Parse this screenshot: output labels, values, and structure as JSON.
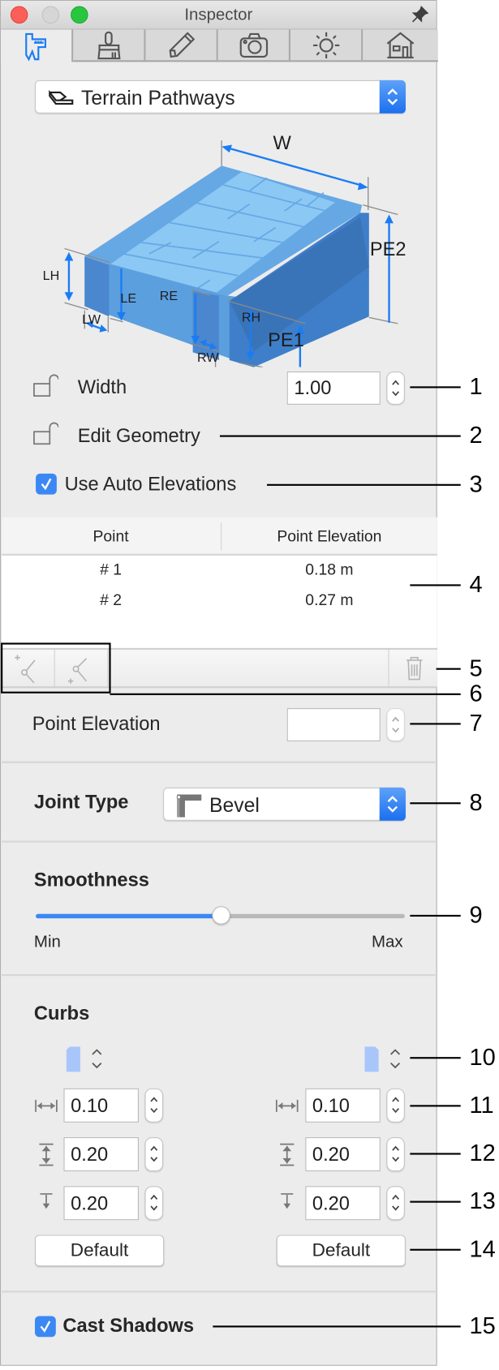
{
  "window": {
    "title": "Inspector",
    "tabs": [
      {
        "name": "measure-tab",
        "icon": "caliper-icon",
        "active": true
      },
      {
        "name": "material-tab",
        "icon": "brush-icon",
        "active": false
      },
      {
        "name": "edit-tab",
        "icon": "pencil-icon",
        "active": false
      },
      {
        "name": "camera-tab",
        "icon": "camera-icon",
        "active": false
      },
      {
        "name": "light-tab",
        "icon": "sun-icon",
        "active": false
      },
      {
        "name": "building-tab",
        "icon": "house-icon",
        "active": false
      }
    ]
  },
  "type_selector": {
    "value": "Terrain Pathways",
    "icon": "terrain-pathway-icon"
  },
  "diagram": {
    "labels": {
      "w": "W",
      "pe2": "PE2",
      "pe1": "PE1",
      "lh": "LH",
      "le": "LE",
      "re": "RE",
      "rh": "RH",
      "lw": "LW",
      "rw": "RW"
    }
  },
  "width": {
    "label": "Width",
    "value": "1.00"
  },
  "edit_geometry": {
    "label": "Edit Geometry"
  },
  "auto_elevations": {
    "label": "Use Auto Elevations",
    "checked": true
  },
  "points_table": {
    "columns": [
      "Point",
      "Point Elevation"
    ],
    "rows": [
      {
        "point": "# 1",
        "elevation": "0.18 m"
      },
      {
        "point": "# 2",
        "elevation": "0.27 m"
      }
    ]
  },
  "point_elevation": {
    "label": "Point Elevation",
    "value": ""
  },
  "joint_type": {
    "label": "Joint Type",
    "value": "Bevel"
  },
  "smoothness": {
    "label": "Smoothness",
    "min_label": "Min",
    "max_label": "Max",
    "value_fraction": 0.5
  },
  "curbs": {
    "label": "Curbs",
    "left": {
      "width": "0.10",
      "height": "0.20",
      "elevation": "0.20",
      "default_label": "Default"
    },
    "right": {
      "width": "0.10",
      "height": "0.20",
      "elevation": "0.20",
      "default_label": "Default"
    }
  },
  "cast_shadows": {
    "label": "Cast Shadows",
    "checked": true
  },
  "callouts": [
    "1",
    "2",
    "3",
    "4",
    "5",
    "6",
    "7",
    "8",
    "9",
    "10",
    "11",
    "12",
    "13",
    "14",
    "15"
  ],
  "colors": {
    "accent": "#3b88f5",
    "close": "#fc5f57",
    "minimize": "#d7d7d7",
    "zoom": "#29c740"
  }
}
